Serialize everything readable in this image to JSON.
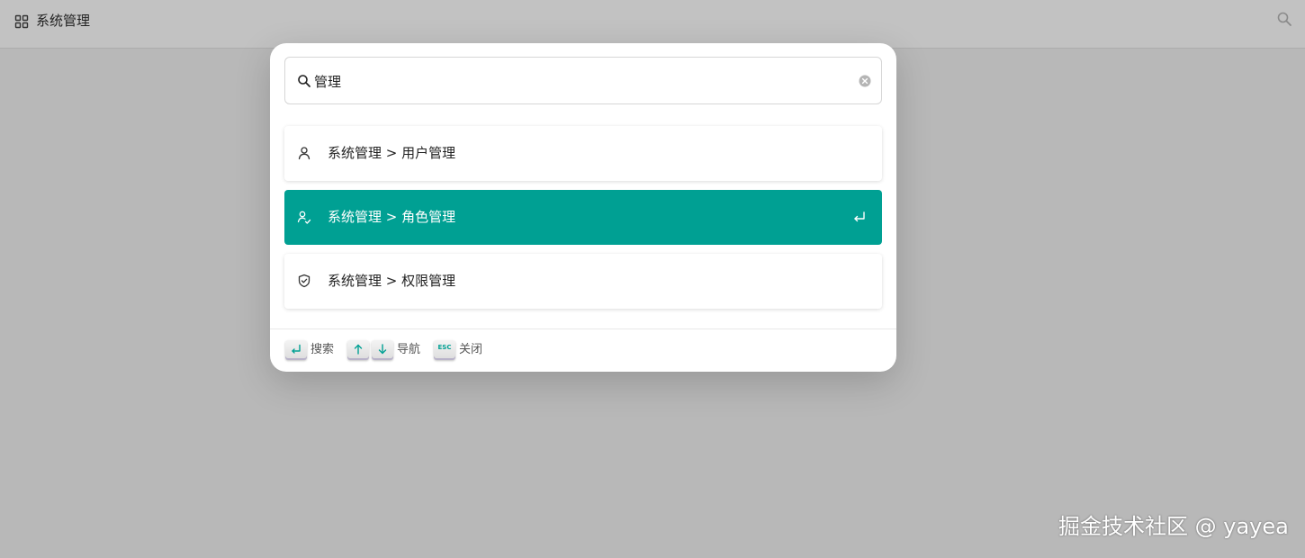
{
  "header": {
    "title": "系统管理",
    "menu_icon": "grid-icon",
    "search_icon": "search-icon"
  },
  "search": {
    "query": "管理",
    "icon": "search-icon",
    "clear_icon": "clear-icon"
  },
  "results": [
    {
      "label": "系统管理 > 用户管理",
      "icon": "user-icon",
      "active": false
    },
    {
      "label": "系统管理 > 角色管理",
      "icon": "role-icon",
      "active": true
    },
    {
      "label": "系统管理 > 权限管理",
      "icon": "shield-icon",
      "active": false
    }
  ],
  "footer": {
    "search_label": "搜索",
    "navigate_label": "导航",
    "close_label": "关闭",
    "esc_key": "ESC"
  },
  "watermark": "掘金技术社区 @ yayea",
  "colors": {
    "accent": "#00a093",
    "overlay": "#b8b8b8",
    "topbar": "#c2c2c2"
  }
}
